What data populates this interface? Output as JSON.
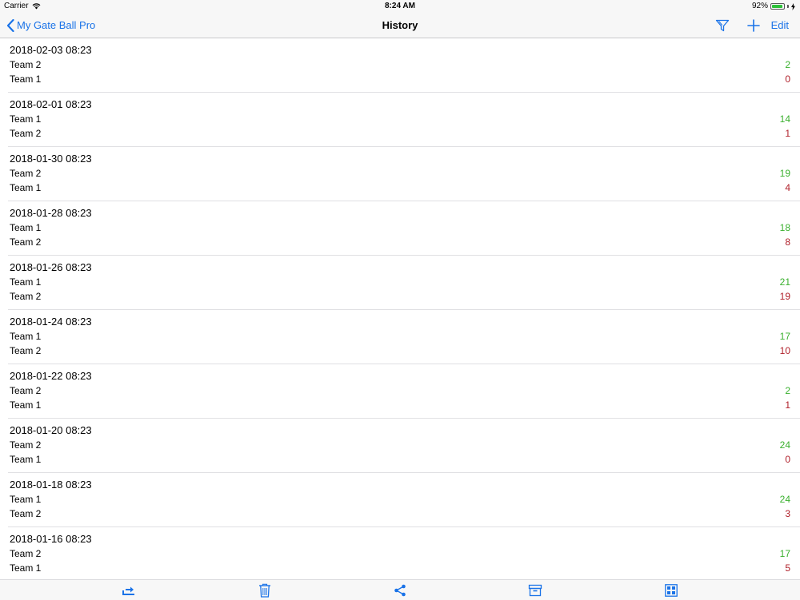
{
  "status_bar": {
    "carrier": "Carrier",
    "time": "8:24 AM",
    "battery_percent": "92%",
    "battery_level": 0.92
  },
  "navbar": {
    "back_label": "My Gate Ball Pro",
    "title": "History",
    "edit_label": "Edit",
    "accent_color": "#1a73e8"
  },
  "history": [
    {
      "date": "2018-02-03 08:23",
      "winner": {
        "team": "Team 2",
        "score": "2"
      },
      "loser": {
        "team": "Team 1",
        "score": "0"
      }
    },
    {
      "date": "2018-02-01 08:23",
      "winner": {
        "team": "Team 1",
        "score": "14"
      },
      "loser": {
        "team": "Team 2",
        "score": "1"
      }
    },
    {
      "date": "2018-01-30 08:23",
      "winner": {
        "team": "Team 2",
        "score": "19"
      },
      "loser": {
        "team": "Team 1",
        "score": "4"
      }
    },
    {
      "date": "2018-01-28 08:23",
      "winner": {
        "team": "Team 1",
        "score": "18"
      },
      "loser": {
        "team": "Team 2",
        "score": "8"
      }
    },
    {
      "date": "2018-01-26 08:23",
      "winner": {
        "team": "Team 1",
        "score": "21"
      },
      "loser": {
        "team": "Team 2",
        "score": "19"
      }
    },
    {
      "date": "2018-01-24 08:23",
      "winner": {
        "team": "Team 1",
        "score": "17"
      },
      "loser": {
        "team": "Team 2",
        "score": "10"
      }
    },
    {
      "date": "2018-01-22 08:23",
      "winner": {
        "team": "Team 2",
        "score": "2"
      },
      "loser": {
        "team": "Team 1",
        "score": "1"
      }
    },
    {
      "date": "2018-01-20 08:23",
      "winner": {
        "team": "Team 2",
        "score": "24"
      },
      "loser": {
        "team": "Team 1",
        "score": "0"
      }
    },
    {
      "date": "2018-01-18 08:23",
      "winner": {
        "team": "Team 1",
        "score": "24"
      },
      "loser": {
        "team": "Team 2",
        "score": "3"
      }
    },
    {
      "date": "2018-01-16 08:23",
      "winner": {
        "team": "Team 2",
        "score": "17"
      },
      "loser": {
        "team": "Team 1",
        "score": "5"
      }
    }
  ],
  "colors": {
    "win_score": "#3ab02e",
    "lose_score": "#b0202a"
  },
  "toolbar": {
    "icons": [
      "export-icon",
      "trash-icon",
      "share-icon",
      "archive-icon",
      "grid-icon"
    ]
  }
}
